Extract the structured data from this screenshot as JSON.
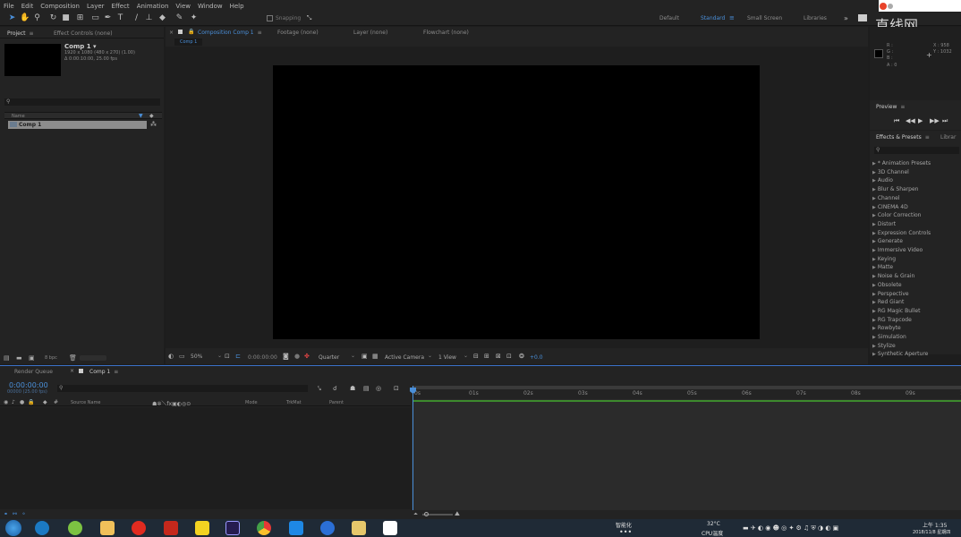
{
  "menu": [
    "File",
    "Edit",
    "Composition",
    "Layer",
    "Effect",
    "Animation",
    "View",
    "Window",
    "Help"
  ],
  "toolbar": {
    "snapping": "Snapping",
    "workspaces": [
      "Default",
      "Standard",
      "Small Screen",
      "Libraries"
    ],
    "active_workspace": "Standard"
  },
  "watermark": "直线网",
  "project_panel": {
    "tabs": [
      "Project",
      "Effect Controls (none)"
    ],
    "comp_name": "Comp 1 ▾",
    "comp_info_1": "1920 x 1080  (480 x 270) (1.00)",
    "comp_info_2": "Δ 0:00:10:00, 25.00 fps",
    "column_name": "Name",
    "item": "Comp 1",
    "bpc": "8 bpc"
  },
  "comp_panel": {
    "tabs": [
      "Composition Comp 1",
      "Footage (none)",
      "Layer (none)",
      "Flowchart (none)"
    ],
    "active_tab": "Composition Comp 1",
    "subtab": "Comp 1",
    "zoom": "50%",
    "timecode": "0:00:00:00",
    "resolution": "Quarter",
    "camera": "Active Camera",
    "views": "1 View",
    "exposure": "+0.0"
  },
  "info_panel": {
    "r": "R :",
    "g": "G :",
    "b": "B :",
    "a": "A : 0",
    "x": "X : 958",
    "y": "Y : 1032"
  },
  "preview_panel": {
    "title": "Preview"
  },
  "effects_panel": {
    "tabs": [
      "Effects & Presets",
      "Librar"
    ],
    "items": [
      "* Animation Presets",
      "3D Channel",
      "Audio",
      "Blur & Sharpen",
      "Channel",
      "CINEMA 4D",
      "Color Correction",
      "Distort",
      "Expression Controls",
      "Generate",
      "Immersive Video",
      "Keying",
      "Matte",
      "Noise & Grain",
      "Obsolete",
      "Perspective",
      "Red Giant",
      "RG Magic Bullet",
      "RG Trapcode",
      "Rowbyte",
      "Simulation",
      "Stylize",
      "Synthetic Aperture"
    ]
  },
  "timeline": {
    "tabs": [
      "Render Queue",
      "Comp 1"
    ],
    "timecode": "0:00:00:00",
    "frames": "00000 (25.00 fps)",
    "col_source": "Source Name",
    "col_mode": "Mode",
    "col_trkmat": "TrkMat",
    "col_parent": "Parent",
    "ticks": [
      "0s",
      "01s",
      "02s",
      "03s",
      "04s",
      "05s",
      "06s",
      "07s",
      "08s",
      "09s",
      "10"
    ]
  },
  "taskbar": {
    "tray_text_1": "智能化",
    "temp": "32°C",
    "temp_label": "CPU温度",
    "time": "上午 1:35",
    "date": "2018/11/8 星期四"
  }
}
